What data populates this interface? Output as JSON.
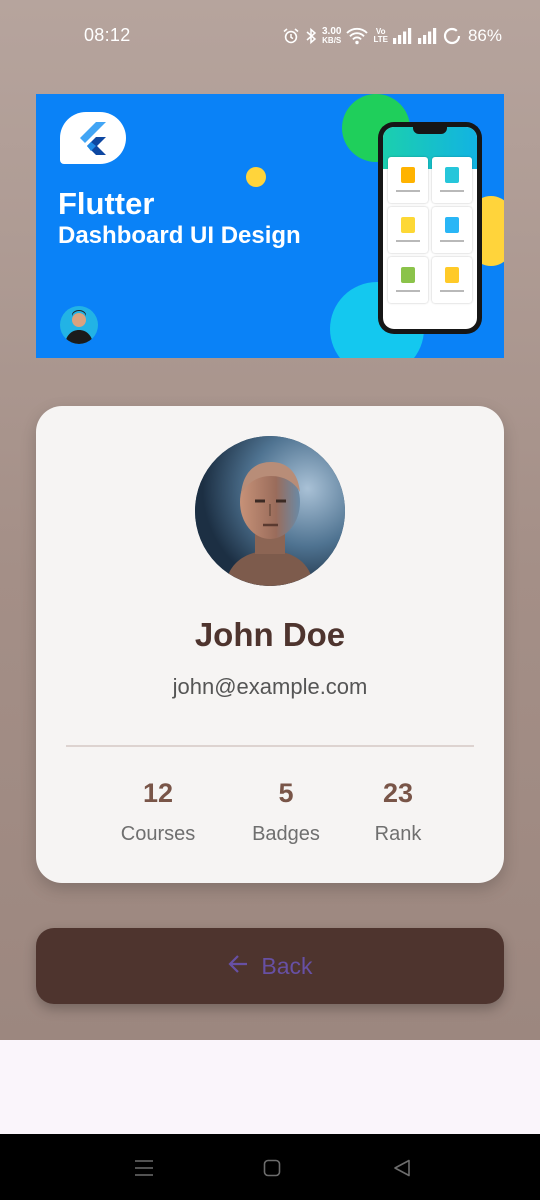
{
  "status_bar": {
    "time": "08:12",
    "net_speed_value": "3.00",
    "net_speed_unit": "KB/S",
    "volte_top": "Vo",
    "volte_bottom": "LTE",
    "battery": "86%"
  },
  "banner": {
    "title": "Flutter",
    "subtitle": "Dashboard UI Design",
    "colors": {
      "background": "#0a82f7",
      "green": "#1fcf5b",
      "yellow": "#ffd43b",
      "cyan": "#14c8ef"
    }
  },
  "profile": {
    "name": "John Doe",
    "email": "john@example.com",
    "stats": [
      {
        "value": "12",
        "label": "Courses"
      },
      {
        "value": "5",
        "label": "Badges"
      },
      {
        "value": "23",
        "label": "Rank"
      }
    ]
  },
  "back_button": {
    "label": "Back",
    "icon": "arrow-left-icon"
  },
  "nav_bar": {
    "icons": [
      "menu-icon",
      "home-square-icon",
      "back-triangle-icon"
    ]
  },
  "colors": {
    "primary_brown": "#4e342e",
    "stat_brown": "#795548",
    "button_text": "#6750a4",
    "card": "#f6f4f3"
  }
}
